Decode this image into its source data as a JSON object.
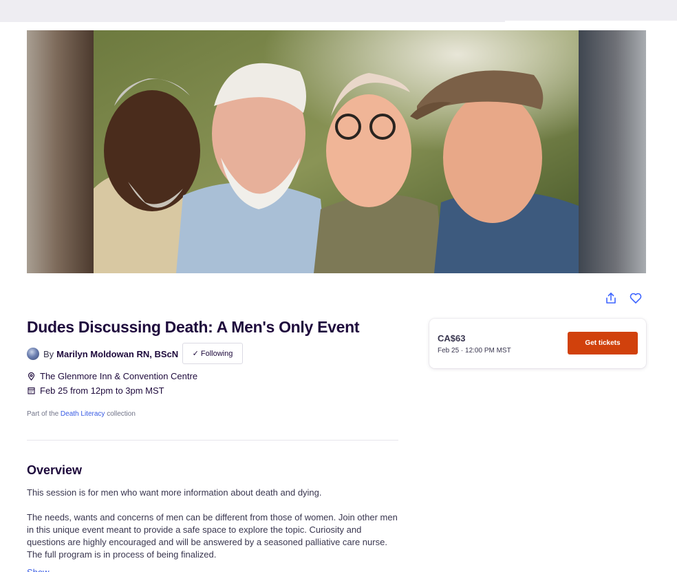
{
  "event": {
    "title": "Dudes Discussing Death: A Men's Only Event",
    "by_prefix": "By",
    "organizer": "Marilyn Moldowan RN, BScN",
    "follow_label": "Following",
    "location": "The Glenmore Inn & Convention Centre",
    "date_time": "Feb 25 from 12pm to 3pm MST",
    "collection_prefix": "Part of the",
    "collection_name": "Death Literacy",
    "collection_suffix": "collection"
  },
  "overview": {
    "heading": "Overview",
    "paragraph1": "This session is for men who want more information about death and dying.",
    "paragraph2": "The needs, wants and concerns of men can be different from those of women. Join other men in this unique event meant to provide a safe space to explore the topic. Curiosity and questions are highly encouraged and will be answered by a seasoned palliative care nurse. The full program is in process of being finalized.",
    "more_link": "Show more"
  },
  "ticket": {
    "price": "CA$63",
    "date": "Feb 25 · 12:00 PM MST",
    "button_label": "Get tickets"
  },
  "icons": {
    "share": "share-icon",
    "like": "heart-icon",
    "location": "map-pin-icon",
    "date": "calendar-icon",
    "check": "check-icon"
  },
  "colors": {
    "title": "#1e0a3c",
    "accent_button": "#d1410c",
    "link": "#3659e3",
    "text": "#39364f",
    "topbar": "#eeedf2"
  }
}
